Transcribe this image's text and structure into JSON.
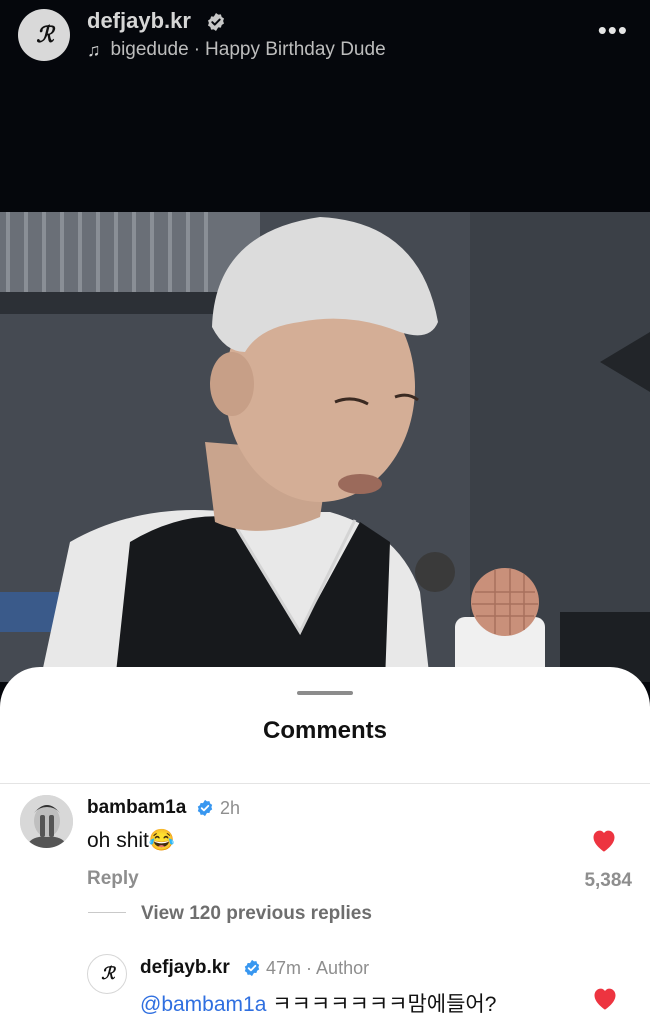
{
  "post": {
    "username": "defjayb.kr",
    "verified": true,
    "music": {
      "icon": "music-note-icon",
      "artist": "bigedude",
      "separator": "·",
      "song": "Happy Birthday Dude"
    },
    "more_icon": "more-horizontal-icon"
  },
  "comments_sheet": {
    "title": "Comments",
    "comment": {
      "username": "bambam1a",
      "verified": true,
      "time": "2h",
      "text": "oh shit😂",
      "liked": true,
      "reply_label": "Reply",
      "like_count": "5,384",
      "view_replies": "View 120 previous replies"
    },
    "reply": {
      "username": "defjayb.kr",
      "verified": true,
      "time": "47m",
      "separator": "·",
      "badge": "Author",
      "mention": "@bambam1a",
      "text": " ㅋㅋㅋㅋㅋㅋㅋ맘에들어?",
      "liked": true
    }
  },
  "colors": {
    "background": "#05070c",
    "sheet": "#ffffff",
    "heart": "#ed3440",
    "verified": "#3897f0",
    "mention": "#2f6fe0",
    "muted": "#8e8e8e"
  }
}
